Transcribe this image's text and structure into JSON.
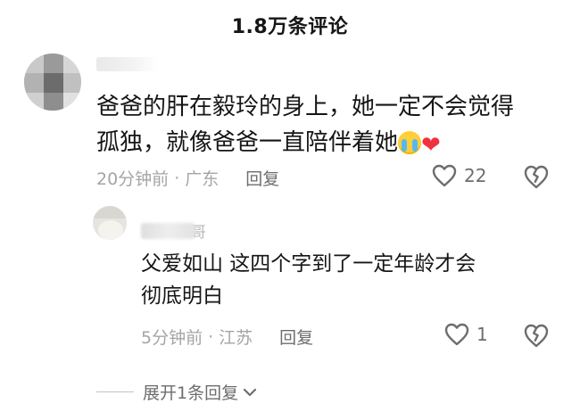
{
  "header": {
    "title": "1.8万条评论"
  },
  "comment": {
    "text_line1": "爸爸的肝在毅玲的身上，她一定不会觉得",
    "text_line2": "孤独，就像爸爸一直陪伴着她",
    "time": "20分钟前",
    "separator": "·",
    "location": "广东",
    "reply_label": "回复",
    "like_count": "22"
  },
  "reply": {
    "username_visible_part": "哥",
    "text_line1": "父爱如山 这四个字到了一定年龄才会",
    "text_line2": "彻底明白",
    "time": "5分钟前",
    "separator": "·",
    "location": "江苏",
    "reply_label": "回复",
    "like_count": "1"
  },
  "expand": {
    "label": "展开1条回复"
  },
  "icons": {
    "like": "heart-outline-icon",
    "dislike": "broken-heart-icon",
    "emoji_cry": "crying-face-emoji",
    "emoji_heart": "red-heart-emoji",
    "expand": "chevron-down-icon"
  },
  "colors": {
    "text_primary": "#161616",
    "text_meta": "#a5a5a5",
    "text_action": "#6d6d6d",
    "heart_emoji": "#f0323e"
  }
}
